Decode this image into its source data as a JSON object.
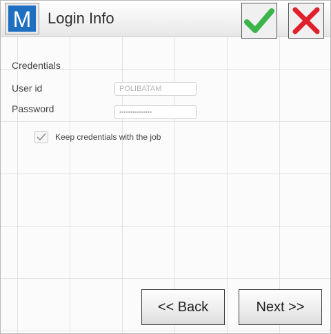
{
  "header": {
    "logo_letter": "M",
    "title": "Login Info",
    "ok_icon": "checkmark-icon",
    "cancel_icon": "close-icon",
    "colors": {
      "logo_bg": "#1e6fc1",
      "ok": "#3bb44a",
      "cancel": "#e0202a"
    }
  },
  "form": {
    "section_label": "Credentials",
    "user_id_label": "User id",
    "user_id_value": "POLIBATAM",
    "password_label": "Password",
    "password_value": "•••••••••••••••",
    "keep_credentials_label": "Keep credentials with the job",
    "keep_credentials_checked": true
  },
  "footer": {
    "back_label": "<< Back",
    "next_label": "Next >>"
  }
}
